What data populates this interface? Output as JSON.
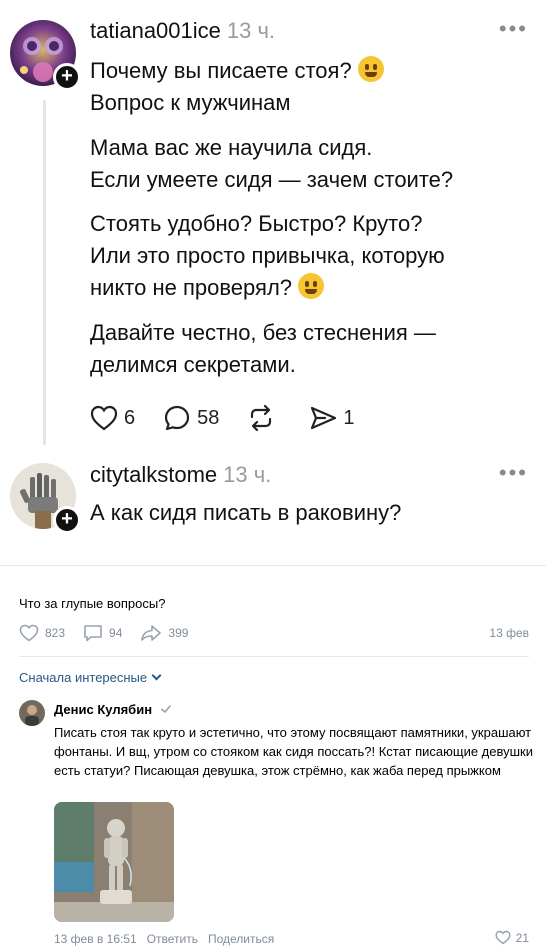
{
  "threads": {
    "post1": {
      "username": "tatiana001ice",
      "time": "13 ч.",
      "menu_icon": "more-dots-icon",
      "follow_icon": "plus-icon",
      "lines": {
        "l1": "Почему вы писаете стоя?",
        "l2": "Вопрос к мужчинам",
        "l3": "Мама вас же научила сидя.",
        "l4": "Если умеете сидя — зачем стоите?",
        "l5": "Стоять удобно? Быстро? Круто?",
        "l6": "Или это просто привычка, которую",
        "l7": "никто не проверял?",
        "l8": "Давайте честно, без стеснения —",
        "l9": "делимся секретами."
      },
      "likes": "6",
      "comments": "58",
      "reposts": "",
      "shares": "1"
    },
    "post2": {
      "username": "citytalkstome",
      "time": "13 ч.",
      "text": "А как сидя писать в раковину?"
    }
  },
  "vk": {
    "post_text": "Что за глупые вопросы?",
    "likes": "823",
    "comments": "94",
    "shares": "399",
    "date": "13 фев",
    "sort_label": "Сначала интересные",
    "comment": {
      "author": "Денис Кулябин",
      "text": "Писать стоя так круто и эстетично, что этому посвящают памятники, украшают фонтаны. И вщ, утром со стояком как сидя поссать?! Кстат писающие девушки есть статуи? Писающая девушка, этож стрёмно, как жаба перед прыжком",
      "time": "13 фев в 16:51",
      "reply_label": "Ответить",
      "share_label": "Поделиться",
      "likes": "21"
    }
  },
  "colors": {
    "vk_link": "#2a5885",
    "vk_meta": "#818c99",
    "threads_time": "#9a9a9a"
  }
}
